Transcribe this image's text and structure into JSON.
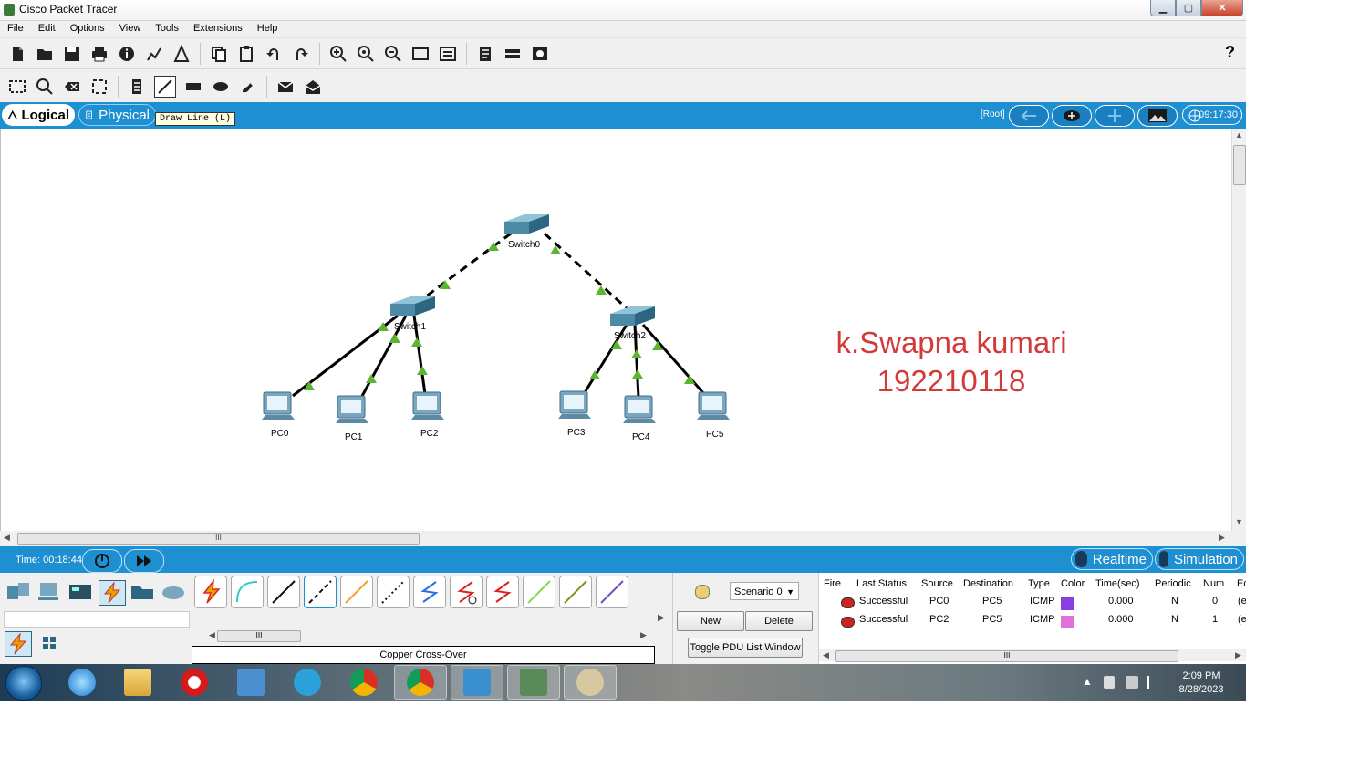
{
  "window": {
    "title": "Cisco Packet Tracer",
    "minimize": "▁",
    "maximize": "▢",
    "close": "✕"
  },
  "menu": [
    "File",
    "Edit",
    "Options",
    "View",
    "Tools",
    "Extensions",
    "Help"
  ],
  "toolbar": {
    "help": "?"
  },
  "tabs": {
    "logical": "Logical",
    "physical": "Physical"
  },
  "tooltip": "Draw Line (L)",
  "topbar": {
    "root": "[Root]",
    "clock": "09:17:30"
  },
  "devices": {
    "switch0": "Switch0",
    "switch1": "Switch1",
    "switch2": "Switch2",
    "pc0": "PC0",
    "pc1": "PC1",
    "pc2": "PC2",
    "pc3": "PC3",
    "pc4": "PC4",
    "pc5": "PC5"
  },
  "annotation": {
    "line1": "k.Swapna kumari",
    "line2": "192210118"
  },
  "scroll": {
    "grip": "III"
  },
  "bottom": {
    "time": "Time: 00:18:44",
    "realtime": "Realtime",
    "simulation": "Simulation"
  },
  "connection_caption": "Copper Cross-Over",
  "scenario": {
    "selected": "Scenario 0",
    "new": "New",
    "delete": "Delete",
    "toggle": "Toggle PDU List Window"
  },
  "events": {
    "headers": [
      "Fire",
      "Last Status",
      "Source",
      "Destination",
      "Type",
      "Color",
      "Time(sec)",
      "Periodic",
      "Num",
      "Ed"
    ],
    "rows": [
      {
        "status": "Successful",
        "source": "PC0",
        "destination": "PC5",
        "type": "ICMP",
        "color": "#8a3ee0",
        "time": "0.000",
        "periodic": "N",
        "num": "0",
        "edit": "(e"
      },
      {
        "status": "Successful",
        "source": "PC2",
        "destination": "PC5",
        "type": "ICMP",
        "color": "#e070d8",
        "time": "0.000",
        "periodic": "N",
        "num": "1",
        "edit": "(e"
      }
    ]
  },
  "taskbar": {
    "time": "2:09 PM",
    "date": "8/28/2023",
    "tray_arrow": "▲"
  },
  "colors": {
    "accent": "#1e8fd0",
    "annotation": "#d23a3a",
    "link_ok": "#5cb531"
  }
}
